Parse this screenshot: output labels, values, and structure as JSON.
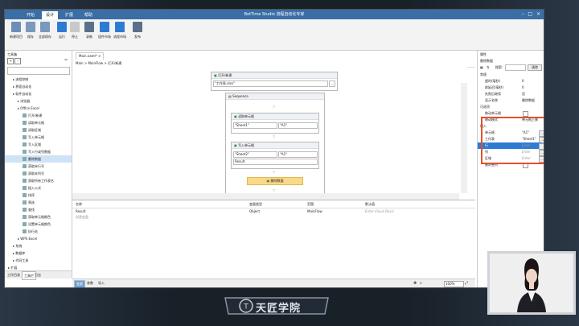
{
  "window": {
    "tabs": [
      "开始",
      "设计",
      "扩展",
      "帮助"
    ],
    "active_tab": "设计",
    "title": "BotTime Studio 流程自动化专家"
  },
  "ribbon": {
    "buttons": [
      {
        "label": "新建项目",
        "icon": "new-project-icon",
        "color": "#6b8fb7"
      },
      {
        "label": "保存",
        "icon": "save-icon",
        "color": "#7a99bc"
      },
      {
        "label": "全部保存",
        "icon": "save-all-icon",
        "color": "#7a99bc"
      },
      {
        "label": "运行",
        "icon": "play-icon",
        "color": "#2f7bd1"
      },
      {
        "label": "停止",
        "icon": "stop-icon",
        "color": "#c9c9c9"
      },
      {
        "label": "录制",
        "icon": "record-icon",
        "color": "#5b6f8a"
      },
      {
        "label": "组件市场",
        "icon": "component-market-icon",
        "color": "#2f7bd1"
      },
      {
        "label": "流程市场",
        "icon": "flow-market-icon",
        "color": "#2f7bd1"
      },
      {
        "label": "发布",
        "icon": "publish-icon",
        "color": "#5b6f8a"
      }
    ]
  },
  "toolbox": {
    "title": "工具箱",
    "items": [
      {
        "label": "流程控制",
        "indent": 1
      },
      {
        "label": "界面自动化",
        "indent": 1
      },
      {
        "label": "软件自动化",
        "indent": 1
      },
      {
        "label": "浏览器",
        "indent": 2
      },
      {
        "label": "Office Excel",
        "indent": 2
      },
      {
        "label": "打开/新建",
        "indent": 3
      },
      {
        "label": "读取单元格",
        "indent": 3
      },
      {
        "label": "读取区域",
        "indent": 3
      },
      {
        "label": "写入单元格",
        "indent": 3
      },
      {
        "label": "写入区域",
        "indent": 3
      },
      {
        "label": "写入行或列数据",
        "indent": 3
      },
      {
        "label": "删除数据",
        "indent": 3,
        "selected": true
      },
      {
        "label": "获取末行号",
        "indent": 3
      },
      {
        "label": "获取末列号",
        "indent": 3
      },
      {
        "label": "获取所有工作表名",
        "indent": 3
      },
      {
        "label": "插入公式",
        "indent": 3
      },
      {
        "label": "排序",
        "indent": 3
      },
      {
        "label": "筛选",
        "indent": 3
      },
      {
        "label": "查找",
        "indent": 3
      },
      {
        "label": "获取单元格颜色",
        "indent": 3
      },
      {
        "label": "设置单元格颜色",
        "indent": 3
      },
      {
        "label": "执行宏",
        "indent": 3
      },
      {
        "label": "WPS Excel",
        "indent": 2
      },
      {
        "label": "系统",
        "indent": 1
      },
      {
        "label": "数据库",
        "indent": 1
      },
      {
        "label": "代码工具",
        "indent": 1
      },
      {
        "label": "扩展",
        "indent": 0
      }
    ],
    "bottom_tabs": [
      "工作目录",
      "工具栏",
      "日志"
    ]
  },
  "document": {
    "tab": "Main.xaml*",
    "breadcrumb": "Main > MainFlow > 打开/新建",
    "open_activity": {
      "title": "打开/新建",
      "path": "\"工作表.xlsx\""
    },
    "sequence": {
      "title": "Sequence"
    },
    "read_cell": {
      "title": "读取单元格",
      "sheet": "\"Sheet1\"",
      "cell": "\"A1\""
    },
    "write_cell": {
      "title": "写入单元格",
      "sheet": "\"Sheet2\"",
      "cell": "\"A1\"",
      "value": "Result"
    },
    "delete_data": {
      "title": "删除数据"
    }
  },
  "variables": {
    "headers": [
      "名称",
      "变量类型",
      "范围",
      "默认值"
    ],
    "rows": [
      [
        "Result",
        "Object",
        "MainFlow",
        "Enter Visual Basic"
      ]
    ],
    "create_hint": "创建变量"
  },
  "bottom_tabs": [
    "变量",
    "参数",
    "导入"
  ],
  "zoom": "100%",
  "properties": {
    "title": "属性",
    "activity": "删除数据",
    "search_label": "搜索:",
    "clear_button": "清除",
    "groups": [
      {
        "label": "常规",
        "rows": [
          {
            "key": "超时(毫秒)",
            "value": "0"
          },
          {
            "key": "前延迟(毫秒)",
            "value": "0"
          },
          {
            "key": "失败后继续",
            "value": "否"
          },
          {
            "key": "显示名称",
            "value": "删除数据"
          }
        ]
      },
      {
        "label": "可选项",
        "rows": [
          {
            "key": "移动单元格",
            "value": ""
          },
          {
            "key": "移动模式",
            "value": "单元格上移"
          }
        ]
      },
      {
        "label": "输入",
        "rows": [
          {
            "key": "单元格",
            "value": "\"A1\""
          },
          {
            "key": "工作表",
            "value": "\"Sheet1\""
          },
          {
            "key": "行",
            "value": "Enter"
          },
          {
            "key": "列",
            "value": "Enter"
          },
          {
            "key": "区域",
            "value": "Enter"
          },
          {
            "key": "删除整列",
            "value": ""
          }
        ]
      }
    ]
  },
  "logo": {
    "text": "天匠学院"
  }
}
